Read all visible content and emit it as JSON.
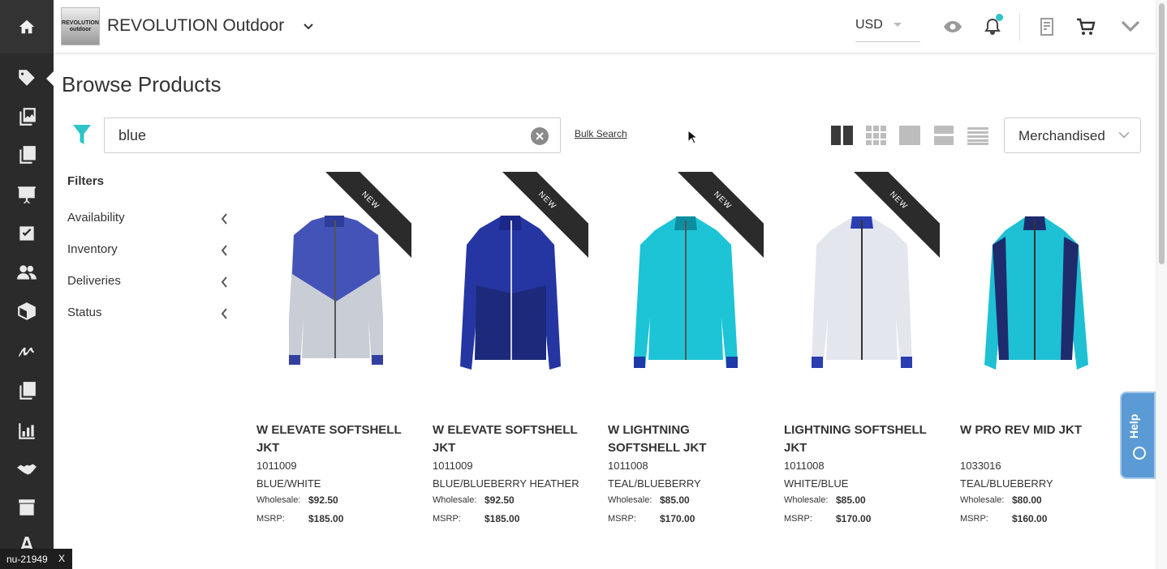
{
  "header": {
    "brand_name": "REVOLUTION Outdoor",
    "logo_line1": "REVOLUTION",
    "logo_line2": "outdoor",
    "currency": "USD"
  },
  "page": {
    "title": "Browse Products",
    "search_value": "blue",
    "bulk_search_label": "Bulk Search",
    "sort_value": "Merchandised"
  },
  "filters": {
    "title": "Filters",
    "items": [
      "Availability",
      "Inventory",
      "Deliveries",
      "Status"
    ]
  },
  "labels": {
    "wholesale": "Wholesale:",
    "msrp": "MSRP:",
    "new_badge": "NEW"
  },
  "products": [
    {
      "name": "W ELEVATE SOFTSHELL JKT",
      "sku": "1011009",
      "color": "BLUE/WHITE",
      "wholesale": "$92.50",
      "msrp": "$185.00",
      "is_new": true
    },
    {
      "name": "W ELEVATE SOFTSHELL JKT",
      "sku": "1011009",
      "color": "BLUE/BLUEBERRY HEATHER",
      "wholesale": "$92.50",
      "msrp": "$185.00",
      "is_new": true
    },
    {
      "name": "W LIGHTNING SOFTSHELL JKT",
      "sku": "1011008",
      "color": "TEAL/BLUEBERRY",
      "wholesale": "$85.00",
      "msrp": "$170.00",
      "is_new": true
    },
    {
      "name": "LIGHTNING SOFTSHELL JKT",
      "sku": "1011008",
      "color": "WHITE/BLUE",
      "wholesale": "$85.00",
      "msrp": "$170.00",
      "is_new": true
    },
    {
      "name": "W PRO REV MID JKT",
      "sku": "1033016",
      "color": "TEAL/BLUEBERRY",
      "wholesale": "$80.00",
      "msrp": "$160.00",
      "is_new": false
    }
  ],
  "help": {
    "label": "Help"
  },
  "session": {
    "id": "nu-21949",
    "close": "X"
  },
  "colors": {
    "accent": "#2ec4c8",
    "rail": "#2b2b2b",
    "help": "#5b9bd5"
  }
}
